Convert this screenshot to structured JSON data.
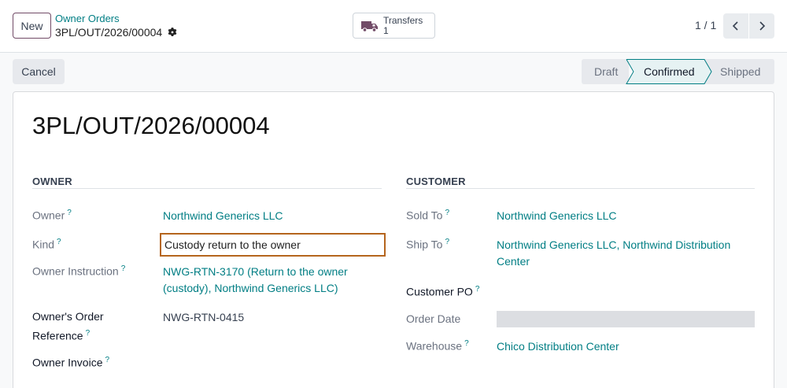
{
  "topbar": {
    "new_label": "New",
    "breadcrumb_parent": "Owner Orders",
    "breadcrumb_current": "3PL/OUT/2026/00004",
    "smart_button": {
      "label": "Transfers",
      "count": "1"
    },
    "pager": "1 / 1"
  },
  "actions": {
    "cancel_label": "Cancel"
  },
  "statusbar": {
    "draft": "Draft",
    "confirmed": "Confirmed",
    "shipped": "Shipped"
  },
  "form": {
    "title": "3PL/OUT/2026/00004",
    "owner_section": {
      "heading": "OWNER",
      "owner_label": "Owner",
      "owner_value": "Northwind Generics LLC",
      "kind_label": "Kind",
      "kind_value": "Custody return to the owner",
      "instruction_label": "Owner Instruction",
      "instruction_value_1": "NWG-RTN-3170 (Return to the owner",
      "instruction_value_2": "(custody), Northwind Generics LLC)",
      "order_ref_label_1": "Owner's Order",
      "order_ref_label_2": "Reference",
      "order_ref_value": "NWG-RTN-0415",
      "invoice_label": "Owner Invoice"
    },
    "customer_section": {
      "heading": "CUSTOMER",
      "sold_to_label": "Sold To",
      "sold_to_value": "Northwind Generics LLC",
      "ship_to_label": "Ship To",
      "ship_to_value_1": "Northwind Generics LLC, Northwind Distribution",
      "ship_to_value_2": "Center",
      "customer_po_label": "Customer PO",
      "order_date_label": "Order Date",
      "warehouse_label": "Warehouse",
      "warehouse_value": "Chico Distribution Center"
    },
    "help_mark": "?"
  },
  "colors": {
    "link": "#017e84",
    "brand": "#714b67",
    "focus_border": "#b5651d"
  }
}
